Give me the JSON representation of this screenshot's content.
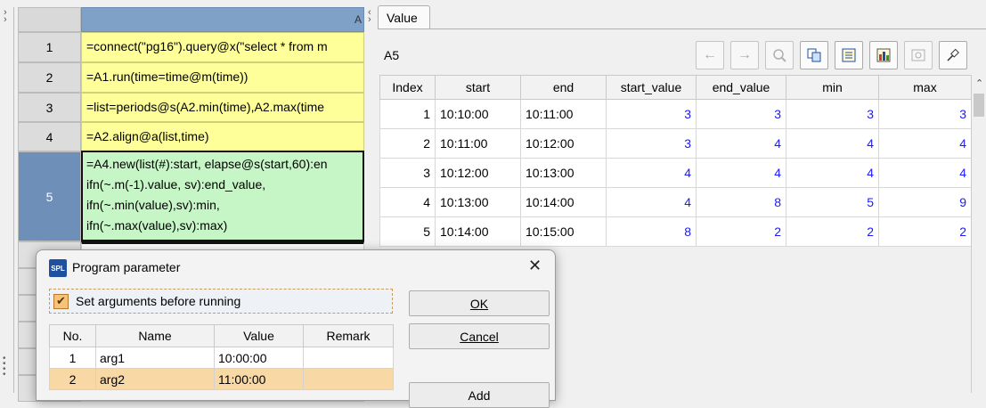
{
  "grid": {
    "col_header": "A",
    "rows": [
      {
        "num": "1",
        "code": "=connect(\"pg16\").query@x(\"select * from m"
      },
      {
        "num": "2",
        "code": "=A1.run(time=time@m(time))"
      },
      {
        "num": "3",
        "code": "=list=periods@s(A2.min(time),A2.max(time"
      },
      {
        "num": "4",
        "code": "=A2.align@a(list,time)"
      },
      {
        "num": "5",
        "lines": [
          "=A4.new(list(#):start, elapse@s(start,60):en",
          "ifn(~.m(-1).value, sv):end_value,",
          "ifn(~.min(value),sv):min,",
          "ifn(~.max(value),sv):max)"
        ]
      }
    ]
  },
  "value_panel": {
    "tab_label": "Value",
    "cell_ref": "A5",
    "toolbar_icons": [
      "back-arrow-icon",
      "forward-arrow-icon",
      "zoom-icon",
      "copy-icon",
      "table-view-icon",
      "chart-icon",
      "properties-icon",
      "pin-icon"
    ],
    "columns": [
      "Index",
      "start",
      "end",
      "start_value",
      "end_value",
      "min",
      "max"
    ],
    "rows": [
      [
        "1",
        "10:10:00",
        "10:11:00",
        "3",
        "3",
        "3",
        "3"
      ],
      [
        "2",
        "10:11:00",
        "10:12:00",
        "3",
        "4",
        "4",
        "4"
      ],
      [
        "3",
        "10:12:00",
        "10:13:00",
        "4",
        "4",
        "4",
        "4"
      ],
      [
        "4",
        "10:13:00",
        "10:14:00",
        "4",
        "8",
        "5",
        "9"
      ],
      [
        "5",
        "10:14:00",
        "10:15:00",
        "8",
        "2",
        "2",
        "2"
      ]
    ]
  },
  "dialog": {
    "icon_text": "SPL",
    "title": "Program parameter",
    "close_symbol": "✕",
    "checkbox_label": "Set arguments before running",
    "checkbox_checked": true,
    "columns": [
      "No.",
      "Name",
      "Value",
      "Remark"
    ],
    "args": [
      {
        "no": "1",
        "name": "arg1",
        "value": "10:00:00",
        "remark": ""
      },
      {
        "no": "2",
        "name": "arg2",
        "value": "11:00:00",
        "remark": ""
      }
    ],
    "buttons": {
      "ok": "OK",
      "cancel": "Cancel",
      "add": "Add"
    }
  }
}
